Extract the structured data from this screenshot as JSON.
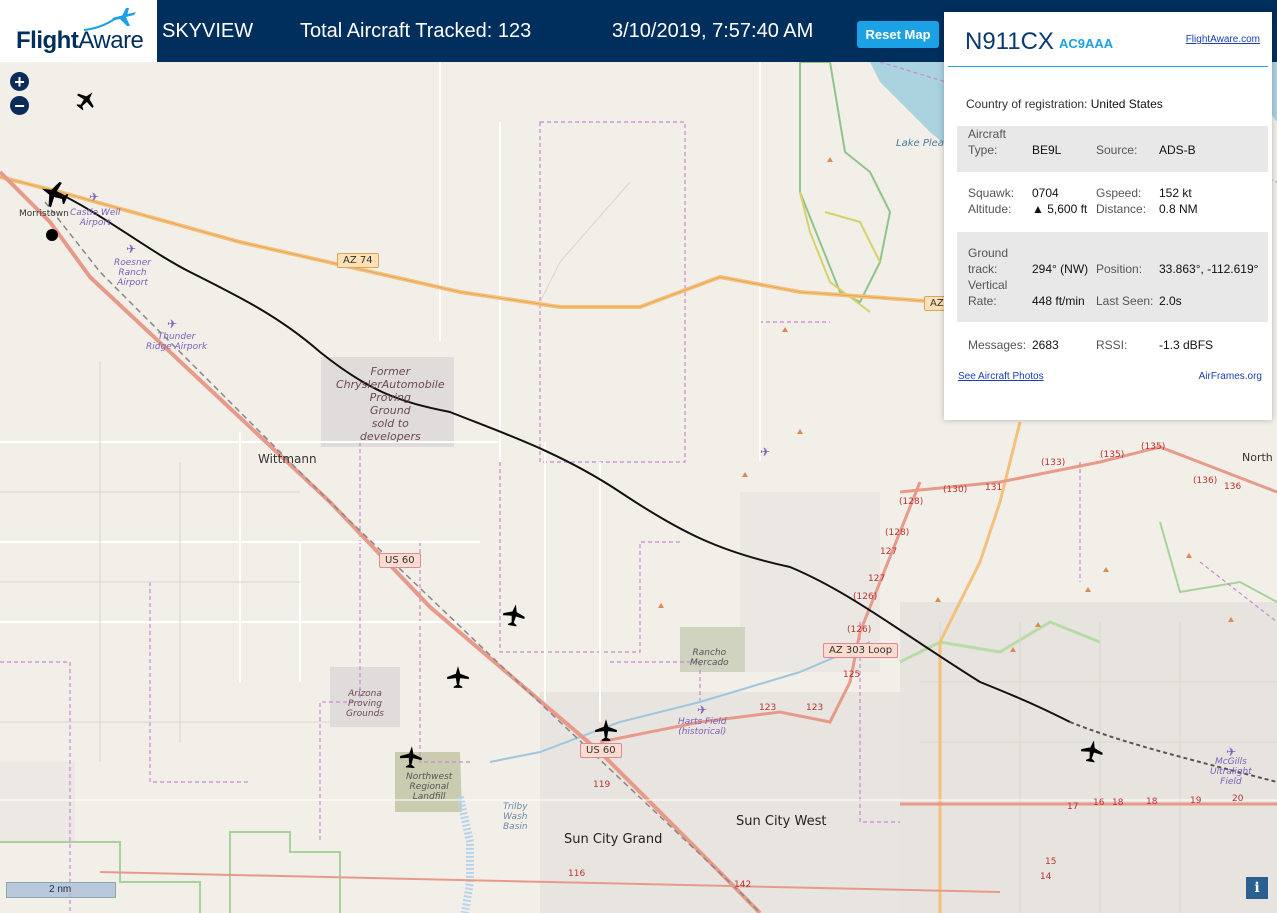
{
  "header": {
    "logo_flight": "Flight",
    "logo_aware": "Aware",
    "app_name": "SKYVIEW",
    "tracked": "Total Aircraft Tracked: 123",
    "datetime": "3/10/2019, 7:57:40 AM",
    "reset_label": "Reset Map"
  },
  "map": {
    "zoom_in": "+",
    "zoom_out": "−",
    "scale": "2 nm",
    "info": "i",
    "labels": {
      "morristown": "Morristown",
      "castle_well": "Castle Well\nAirport",
      "roesner": "Roesner\nRanch\nAirport",
      "thunder_ridge": "Thunder\nRidge Airpork",
      "chrysler": "Former\nChryslerAutomobile\nProving\nGround\nsold to\ndevelopers",
      "wittmann": "Wittmann",
      "rancho": "Rancho\nMercado",
      "az_proving": "Arizona\nProving\nGrounds",
      "landfill": "Northwest\nRegional\nLandfill",
      "harts": "Harts Field\n(historical)",
      "trilby": "Trilby\nWash\nBasin",
      "sun_city_grand": "Sun City Grand",
      "sun_city_west": "Sun City West",
      "mcgills": "McGills\nUltralight\nField",
      "north": "North",
      "lake": "Lake Pleas"
    },
    "shields": {
      "az74": "AZ 74",
      "us60_a": "US 60",
      "us60_b": "US 60",
      "az303": "AZ 303 Loop",
      "az_edge": "AZ"
    },
    "routes": [
      "(135)",
      "(135)",
      "(133)",
      "(136)",
      "136",
      "131",
      "(130)",
      "(128)",
      "(128)",
      "127",
      "127",
      "(126)",
      "(126)",
      "125",
      "123",
      "123",
      "119",
      "116",
      "142",
      "17",
      "16",
      "18",
      "18",
      "19",
      "20",
      "15",
      "14"
    ]
  },
  "panel": {
    "ident": "N911CX",
    "hex": "AC9AAA",
    "fa_link": "FlightAware.com",
    "country_label": "Country of registration:",
    "country": "United States",
    "aircraft_type_label_1": "Aircraft",
    "aircraft_type_label_2": "Type:",
    "aircraft_type": "BE9L",
    "source_label": "Source:",
    "source": "ADS-B",
    "squawk_label": "Squawk:",
    "squawk": "0704",
    "gspeed_label": "Gspeed:",
    "gspeed": "152 kt",
    "altitude_label": "Altitude:",
    "altitude": "▲ 5,600 ft",
    "distance_label": "Distance:",
    "distance": "0.8 NM",
    "ground_label_1": "Ground",
    "ground_label_2": "track:",
    "ground_track": "294° (NW)",
    "position_label": "Position:",
    "position": "33.863°, -112.619°",
    "vertical_label_1": "Vertical",
    "vertical_label_2": "Rate:",
    "vertical_rate": "448 ft/min",
    "last_seen_label": "Last Seen:",
    "last_seen": "2.0s",
    "messages_label": "Messages:",
    "messages": "2683",
    "rssi_label": "RSSI:",
    "rssi": "-1.3 dBFS",
    "photos_link": "See Aircraft Photos",
    "airframes_link": "AirFrames.org"
  },
  "colors": {
    "header_bg": "#002f5d",
    "accent": "#1da1e5"
  }
}
